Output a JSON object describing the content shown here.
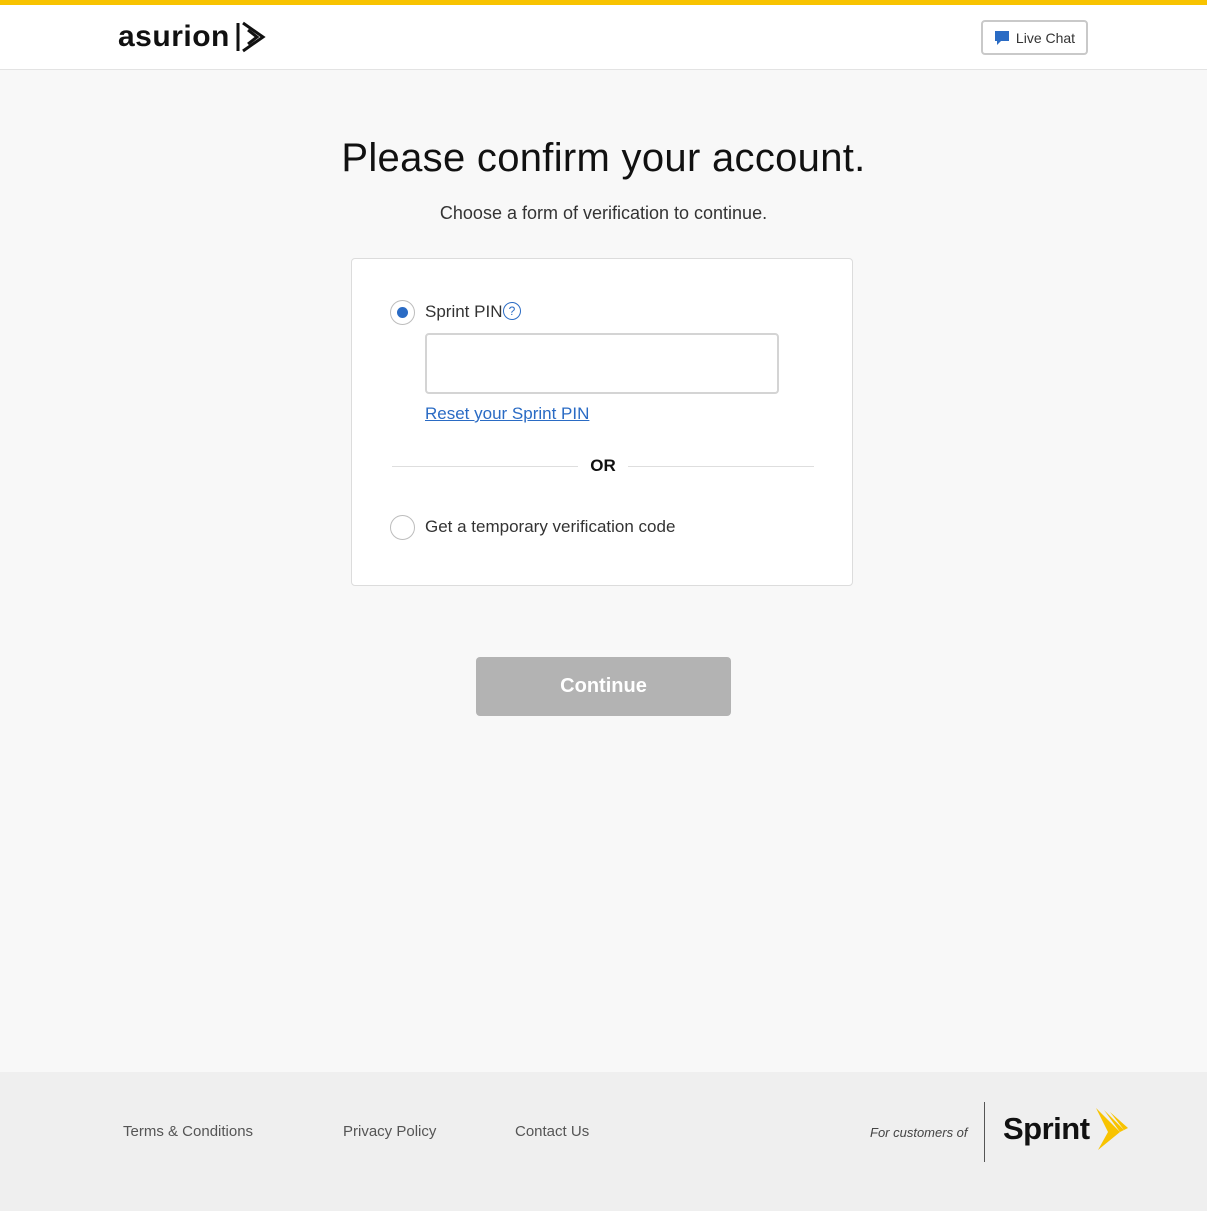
{
  "header": {
    "brand_text": "asurion",
    "live_chat_label": "Live Chat"
  },
  "main": {
    "title": "Please confirm your account.",
    "subtitle": "Choose a form of verification to continue.",
    "options": {
      "pin_label": "Sprint PIN",
      "pin_help_glyph": "?",
      "pin_value": "",
      "reset_link": "Reset your Sprint PIN",
      "or_text": "OR",
      "temp_code_label": "Get a temporary verification code",
      "selected": "sprint_pin"
    },
    "continue_label": "Continue"
  },
  "footer": {
    "links": [
      "Terms & Conditions",
      "Privacy Policy",
      "Contact Us"
    ],
    "for_customers": "For customers of",
    "partner_brand": "Sprint"
  },
  "colors": {
    "accent_yellow": "#f8c300",
    "link_blue": "#2a6bc4",
    "disabled_button": "#b3b3b3"
  }
}
